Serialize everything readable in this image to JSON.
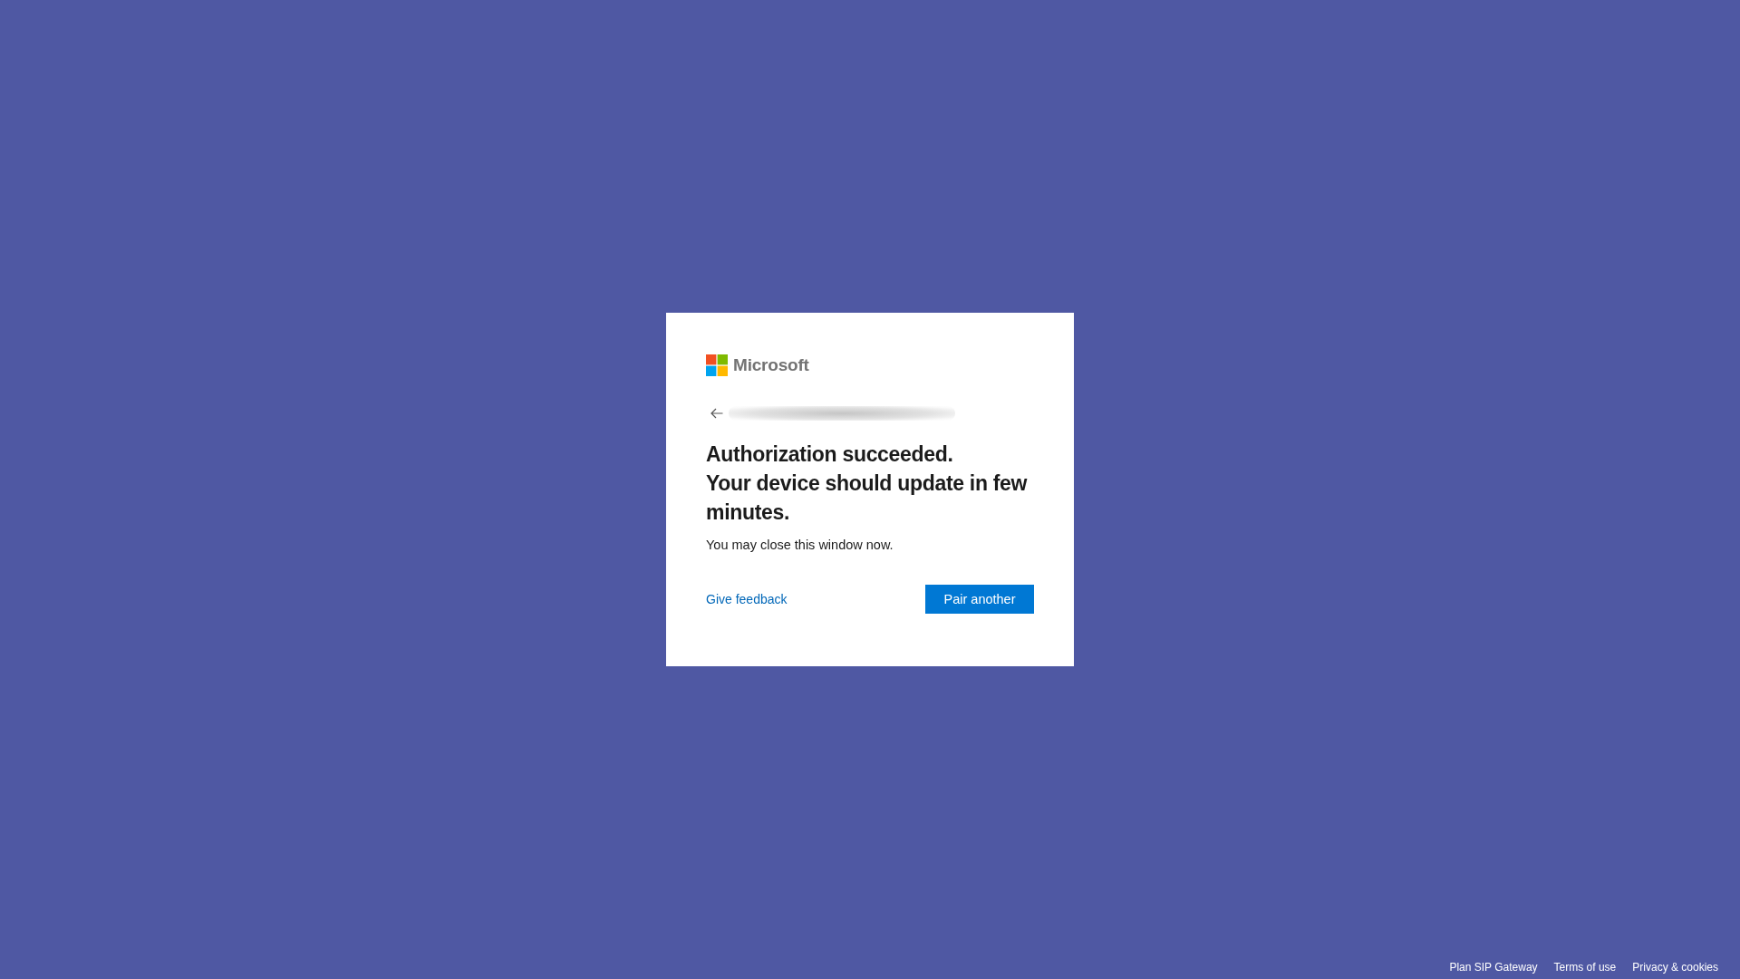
{
  "logo": {
    "text": "Microsoft"
  },
  "heading": [
    "Authorization succeeded.",
    "Your device should update in few minutes."
  ],
  "message": "You may close this window now.",
  "feedback_link": "Give feedback",
  "primary_button": "Pair another",
  "footer_links": [
    "Plan SIP Gateway",
    "Terms of use",
    "Privacy & cookies"
  ]
}
